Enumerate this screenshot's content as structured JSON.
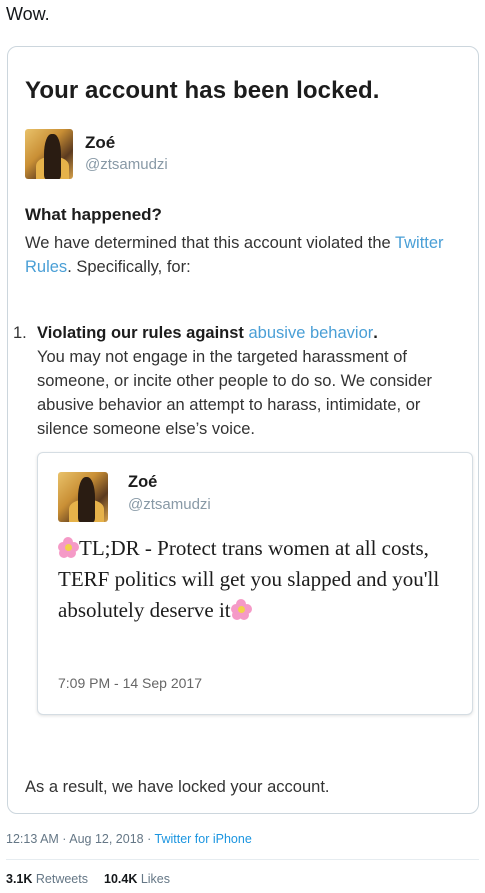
{
  "tweet": {
    "text": "Wow.",
    "timestamp": "12:13 AM · Aug 12, 2018 · ",
    "source": "Twitter for iPhone",
    "retweets_count": "3.1K",
    "retweets_label": " Retweets",
    "likes_count": "10.4K",
    "likes_label": " Likes"
  },
  "lock_notice": {
    "title": "Your account has been locked.",
    "user": {
      "name": "Zoé",
      "handle": "@ztsamudzi"
    },
    "what_happened_heading": "What happened?",
    "what_happened_text_1": "We have determined that this account violated the ",
    "twitter_rules_link": "Twitter Rules",
    "what_happened_text_2": ". Specifically, for:",
    "rule_number": "1.",
    "rule_heading": "Violating our rules against ",
    "rule_link": "abusive behavior",
    "rule_heading_end": ".",
    "rule_body": "You may not engage in the targeted harassment of someone, or incite other people to do so. We consider abusive behavior an attempt to harass, intimidate, or silence someone else’s voice.",
    "result_text": "As a result, we have locked your account."
  },
  "quoted_tweet": {
    "name": "Zoé",
    "handle": "@ztsamudzi",
    "text": "TL;DR - Protect trans women at all costs, TERF politics will get you slapped and you'll absolutely deserve it",
    "emoji": "cherry-blossom-icon",
    "time": "7:09 PM - 14 Sep 2017"
  }
}
